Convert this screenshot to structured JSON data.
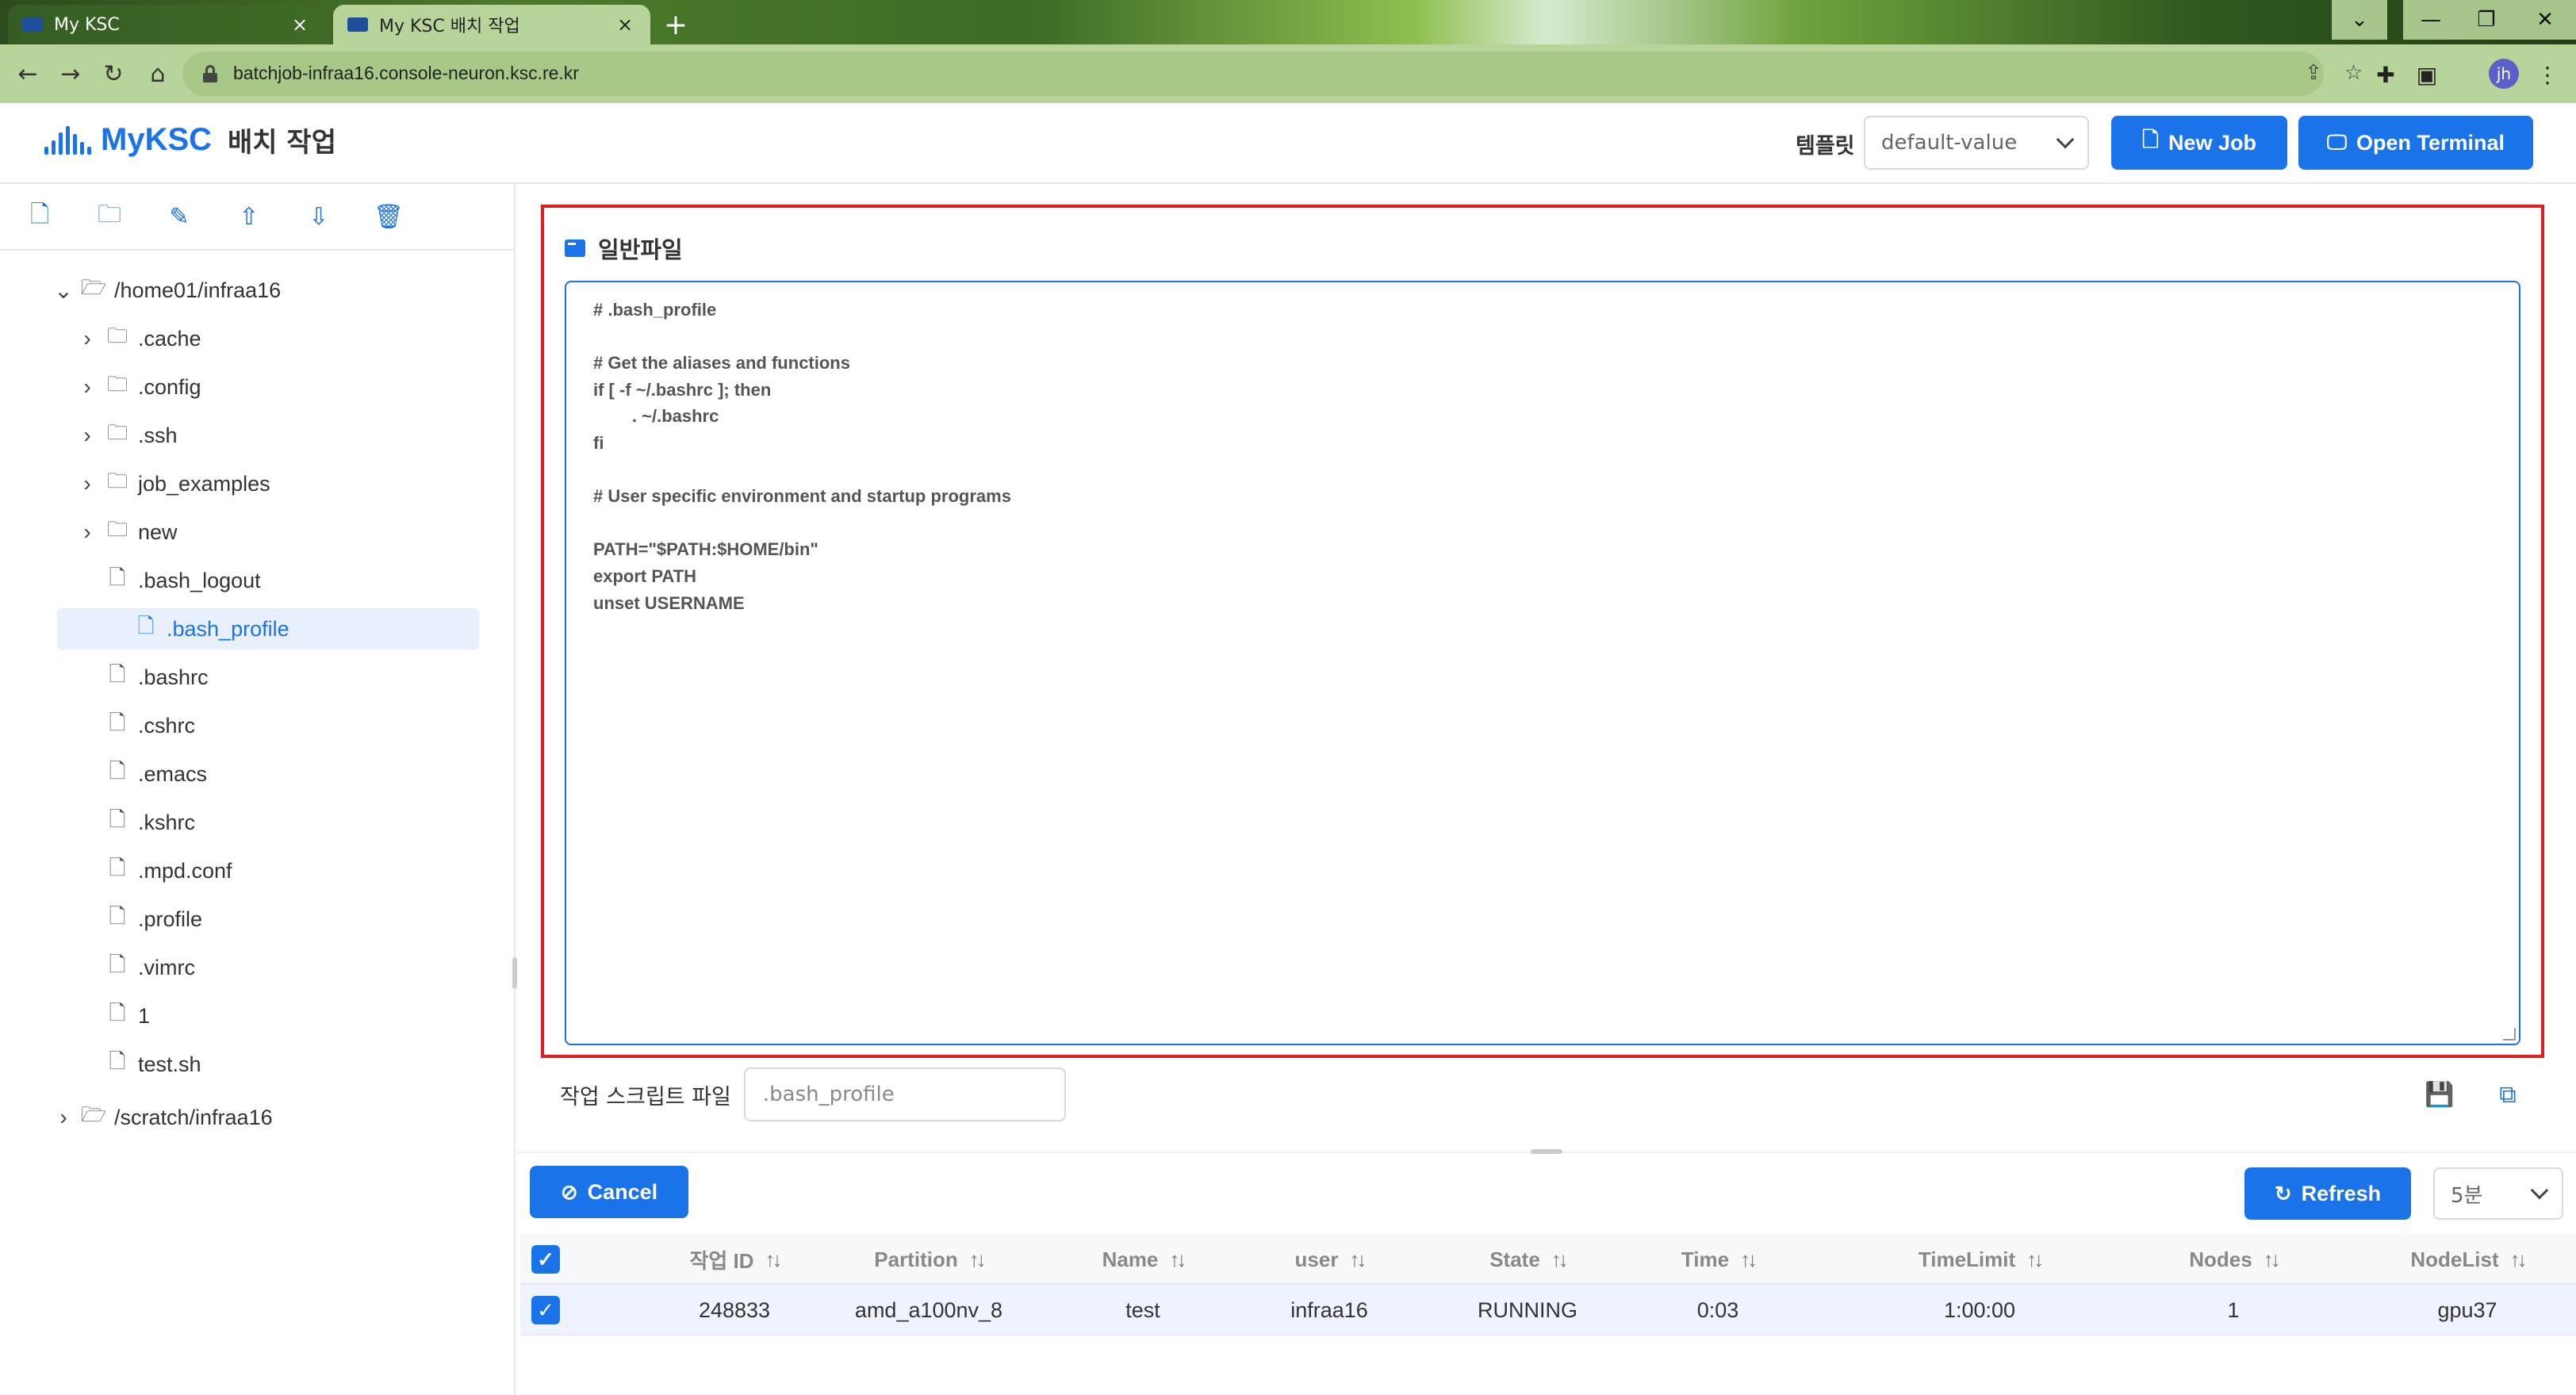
{
  "browser": {
    "tabs": [
      {
        "title": "My KSC",
        "close": "×"
      },
      {
        "title": "My KSC 배치 작업",
        "close": "×"
      }
    ],
    "new_tab": "+",
    "url": "batchjob-infraa16.console-neuron.ksc.re.kr",
    "profile_initials": "jh"
  },
  "header": {
    "logo": "MyKSC",
    "subtitle": "배치 작업",
    "template_label": "템플릿",
    "template_value": "default-value",
    "new_job": "New Job",
    "open_terminal": "Open Terminal"
  },
  "sidebar": {
    "tree": [
      {
        "label": "/home01/infraa16",
        "type": "folder-open",
        "arrow": "down",
        "depth": 0
      },
      {
        "label": ".cache",
        "type": "folder",
        "arrow": "right",
        "depth": 1
      },
      {
        "label": ".config",
        "type": "folder",
        "arrow": "right",
        "depth": 1
      },
      {
        "label": ".ssh",
        "type": "folder",
        "arrow": "right",
        "depth": 1
      },
      {
        "label": "job_examples",
        "type": "folder",
        "arrow": "right",
        "depth": 1
      },
      {
        "label": "new",
        "type": "folder",
        "arrow": "right",
        "depth": 1
      },
      {
        "label": ".bash_logout",
        "type": "file",
        "arrow": "",
        "depth": 1
      },
      {
        "label": ".bash_profile",
        "type": "file",
        "arrow": "",
        "depth": 1,
        "selected": true
      },
      {
        "label": ".bashrc",
        "type": "file",
        "arrow": "",
        "depth": 1
      },
      {
        "label": ".cshrc",
        "type": "file",
        "arrow": "",
        "depth": 1
      },
      {
        "label": ".emacs",
        "type": "file",
        "arrow": "",
        "depth": 1
      },
      {
        "label": ".kshrc",
        "type": "file",
        "arrow": "",
        "depth": 1
      },
      {
        "label": ".mpd.conf",
        "type": "file",
        "arrow": "",
        "depth": 1
      },
      {
        "label": ".profile",
        "type": "file",
        "arrow": "",
        "depth": 1
      },
      {
        "label": ".vimrc",
        "type": "file",
        "arrow": "",
        "depth": 1
      },
      {
        "label": "1",
        "type": "file",
        "arrow": "",
        "depth": 1
      },
      {
        "label": "test.sh",
        "type": "file",
        "arrow": "",
        "depth": 1
      },
      {
        "label": "/scratch/infraa16",
        "type": "folder-open",
        "arrow": "right",
        "depth": 0
      }
    ]
  },
  "editor": {
    "title": "일반파일",
    "lines": [
      "# .bash_profile",
      "",
      "# Get the aliases and functions",
      "if [ -f ~/.bashrc ]; then",
      "        . ~/.bashrc",
      "fi",
      "",
      "# User specific environment and startup programs",
      "",
      "PATH=\"$PATH:$HOME/bin\"",
      "export PATH",
      "unset USERNAME"
    ],
    "script_label": "작업 스크립트 파일",
    "script_value": ".bash_profile"
  },
  "jobs": {
    "cancel": "Cancel",
    "refresh": "Refresh",
    "interval": "5분",
    "columns": [
      "작업 ID",
      "Partition",
      "Name",
      "user",
      "State",
      "Time",
      "TimeLimit",
      "Nodes",
      "NodeList"
    ],
    "rows": [
      {
        "id": "248833",
        "partition": "amd_a100nv_8",
        "name": "test",
        "user": "infraa16",
        "state": "RUNNING",
        "time": "0:03",
        "timelimit": "1:00:00",
        "nodes": "1",
        "nodelist": "gpu37"
      }
    ]
  },
  "colors": {
    "accent": "#1a73e8",
    "highlight_border": "#e02020"
  }
}
